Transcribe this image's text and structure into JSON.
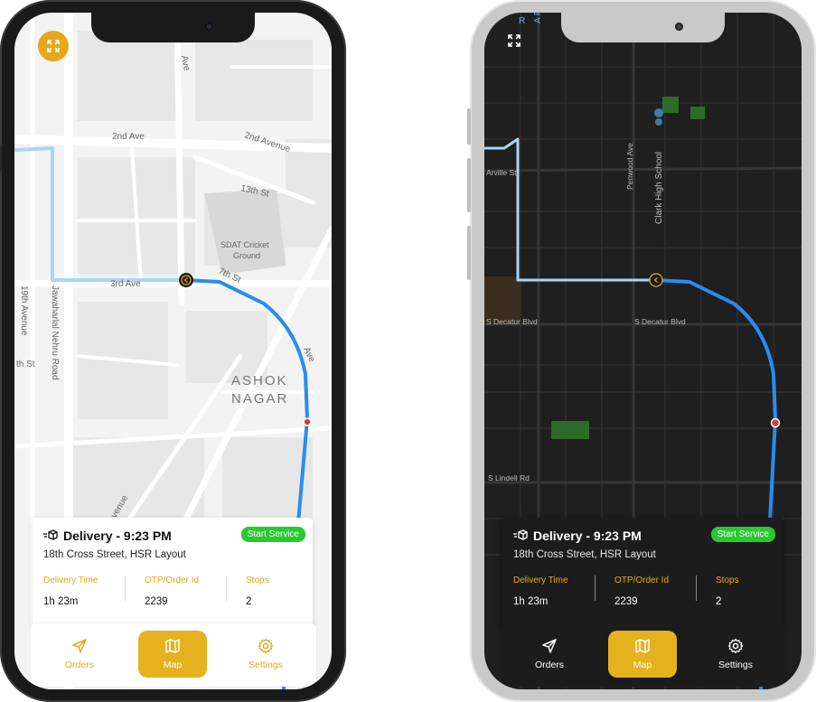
{
  "light": {
    "map_labels": {
      "ave_top": "Ave",
      "second_ave": "2nd Ave",
      "second_avenue": "2nd Avenue",
      "thirteenth_st": "13th St",
      "sdat_cricket_1": "SDAT Cricket",
      "sdat_cricket_2": "Ground",
      "seventh_st": "7th St",
      "third_ave": "3rd Ave",
      "nineteenth_avenue": "19th Avenue",
      "th_st": "th St",
      "jawaharlal": "Jawaharlal Nehru Road",
      "ashok": "ASHOK",
      "nagar": "NAGAR",
      "venue": "venue",
      "ave_right": "Ave"
    },
    "card": {
      "title": "Delivery - 9:23 PM",
      "badge": "Start Service",
      "address": "18th Cross Street,  HSR Layout",
      "stats": [
        {
          "label": "Delivery Time",
          "value": "1h 23m"
        },
        {
          "label": "OTP/Order Id",
          "value": "2239"
        },
        {
          "label": "Stops",
          "value": "2"
        }
      ]
    },
    "nav": [
      {
        "label": "Orders",
        "icon": "send-icon"
      },
      {
        "label": "Map",
        "icon": "map-icon"
      },
      {
        "label": "Settings",
        "icon": "gear-icon"
      }
    ]
  },
  "dark": {
    "map_labels": {
      "arville": "Arville St",
      "penwood": "Penwood Ave",
      "clark": "Clark High School",
      "decatur_left": "S Decatur Blvd",
      "decatur_right": "S Decatur Blvd",
      "lindell": "S Lindell Rd",
      "top_r": "R",
      "top_ap": "A P"
    },
    "card": {
      "title": "Delivery - 9:23 PM",
      "badge": "Start Service",
      "address": "18th Cross Street,  HSR Layout",
      "stats": [
        {
          "label": "Delivery Time",
          "value": "1h 23m"
        },
        {
          "label": "OTP/Order Id",
          "value": "2239"
        },
        {
          "label": "Stops",
          "value": "2"
        }
      ]
    },
    "nav": [
      {
        "label": "Orders",
        "icon": "send-icon"
      },
      {
        "label": "Map",
        "icon": "map-icon"
      },
      {
        "label": "Settings",
        "icon": "gear-icon"
      }
    ]
  },
  "colors": {
    "accent": "#e5a81c",
    "route": "#2a8cf0",
    "route_past": "#a9d6f7",
    "badge": "#2bc730",
    "destination": "#e53935"
  }
}
